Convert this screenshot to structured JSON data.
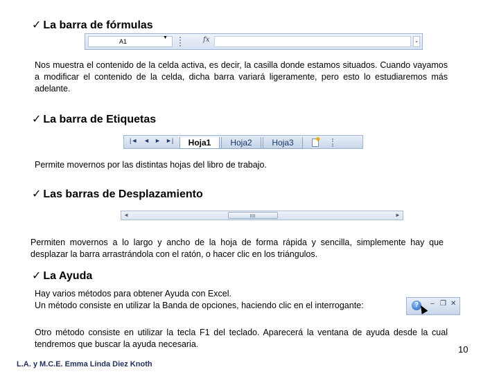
{
  "sections": {
    "formula": {
      "heading": "La barra de fórmulas",
      "paragraph": "Nos muestra el contenido de la celda activa, es decir, la casilla donde estamos situados. Cuando vayamos a modificar el contenido de la celda, dicha barra variará ligeramente, pero esto lo estudiaremos más adelante."
    },
    "tabs": {
      "heading": "La barra de Etiquetas",
      "paragraph": "Permite movernos por las distintas hojas del libro de trabajo."
    },
    "scroll": {
      "heading": "Las barras de Desplazamiento",
      "paragraph": "Permiten movernos a lo largo y ancho de la hoja de forma rápida y sencilla, simplemente hay que desplazar la barra arrastrándola con el ratón, o hacer clic en los triángulos."
    },
    "help": {
      "heading": "La Ayuda",
      "line1": "Hay  varios métodos para obtener Ayuda con Excel.",
      "line2": "Un método consiste en utilizar la Banda de opciones, haciendo clic en el interrogante:",
      "paragraph2": "Otro método consiste en utilizar la tecla F1 del teclado. Aparecerá la ventana de ayuda desde la cual tendremos que buscar la ayuda necesaria."
    }
  },
  "check_glyph": "✓",
  "formula_bar": {
    "cell": "A1",
    "fx": "fx"
  },
  "sheet_tabs": [
    "Hoja1",
    "Hoja2",
    "Hoja3"
  ],
  "nav_glyphs": [
    "|◄",
    "◄",
    "►",
    "►|"
  ],
  "page_number": "10",
  "author": "L.A. y M.C.E. Emma Linda Diez Knoth",
  "colors": {
    "bar_border": "#9fb4cf",
    "tab_text": "#17376a",
    "author_text": "#1c2f5a"
  }
}
